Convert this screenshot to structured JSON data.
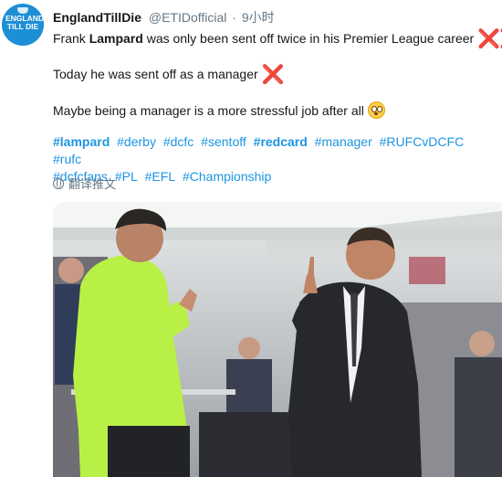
{
  "tweet": {
    "display_name": "EnglandTillDie",
    "handle": "@ETIDofficial",
    "separator": "·",
    "time": "9小时",
    "avatar_text": [
      "ENGLAND",
      "TILL DIE"
    ],
    "lines": [
      {
        "pre": "Frank ",
        "bold": "Lampard",
        "post": " was only been sent off twice in his Premier League career",
        "mark": "❌❌"
      },
      {
        "pre": "Today he was sent off as a manager",
        "mark": "❌"
      },
      {
        "pre": "Maybe being a manager is a more stressful job after all",
        "emoji": "flushed-face"
      }
    ],
    "hashtags": [
      "#lampard",
      "#derby",
      "#dcfc",
      "#sentoff",
      "#redcard",
      "#manager",
      "#RUFCvDCFC",
      "#rufc",
      "#dcfcfans",
      "#PL",
      "#EFL",
      "#Championship"
    ],
    "bold_hashtags": [
      "#lampard",
      "#redcard"
    ],
    "translate_label": "翻译推文",
    "colors": {
      "link": "#1b95e0",
      "muted": "#657786",
      "x_mark": "#dd2e44",
      "avatar": "#1d8fd6"
    }
  }
}
